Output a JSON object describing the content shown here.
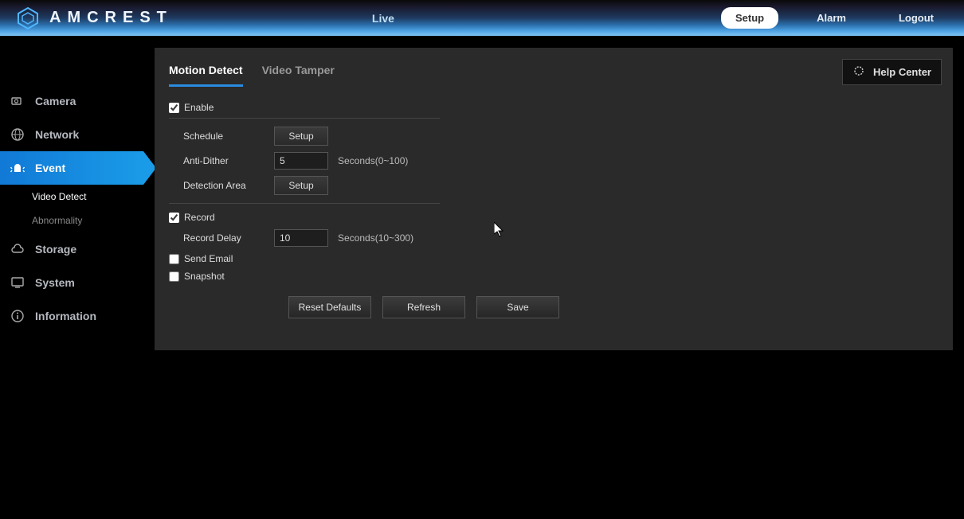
{
  "brand": "AMCREST",
  "main_nav": {
    "live": "Live"
  },
  "right_nav": {
    "setup": "Setup",
    "alarm": "Alarm",
    "logout": "Logout"
  },
  "sidebar": {
    "camera": "Camera",
    "network": "Network",
    "event": "Event",
    "event_sub": {
      "video_detect": "Video Detect",
      "abnormality": "Abnormality"
    },
    "storage": "Storage",
    "system": "System",
    "information": "Information"
  },
  "tabs": {
    "motion_detect": "Motion Detect",
    "video_tamper": "Video Tamper"
  },
  "help_center": "Help Center",
  "form": {
    "enable": "Enable",
    "schedule": "Schedule",
    "setup_btn": "Setup",
    "anti_dither": "Anti-Dither",
    "anti_dither_val": "5",
    "anti_dither_hint": "Seconds(0~100)",
    "detection_area": "Detection Area",
    "record": "Record",
    "record_delay": "Record Delay",
    "record_delay_val": "10",
    "record_delay_hint": "Seconds(10~300)",
    "send_email": "Send Email",
    "snapshot": "Snapshot"
  },
  "actions": {
    "reset": "Reset Defaults",
    "refresh": "Refresh",
    "save": "Save"
  }
}
